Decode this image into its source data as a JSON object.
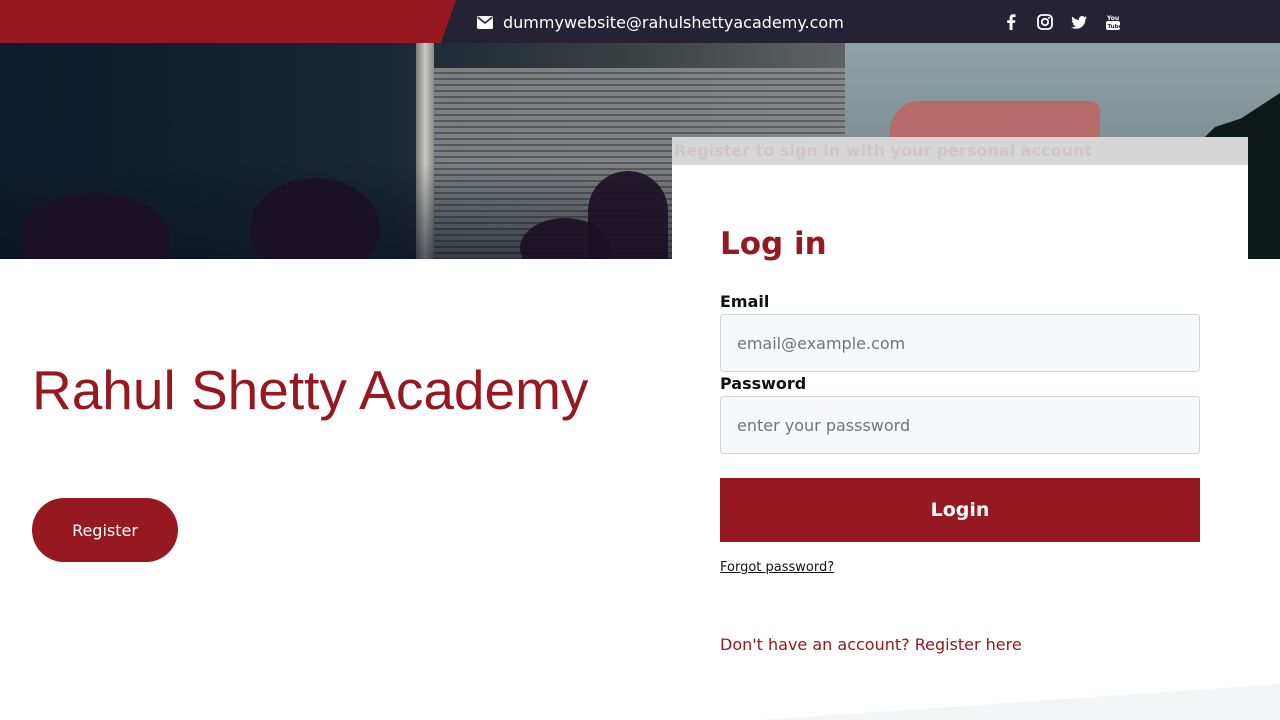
{
  "topbar": {
    "email": "dummywebsite@rahulshettyacademy.com",
    "email_icon": "envelope-icon",
    "social_icons": [
      "facebook-icon",
      "instagram-icon",
      "twitter-icon",
      "youtube-icon"
    ]
  },
  "banner": {
    "text": "Register to sign in with your personal account"
  },
  "brand": {
    "title": "Rahul Shetty Academy",
    "register_button": "Register"
  },
  "login": {
    "title": "Log in",
    "email_label": "Email",
    "email_placeholder": "email@example.com",
    "email_value": "",
    "password_label": "Password",
    "password_placeholder": "enter your passsword",
    "password_value": "",
    "login_button": "Login",
    "forgot_password": "Forgot password?",
    "register_link": "Don't have an account? Register here"
  },
  "colors": {
    "brand_red": "#961820",
    "topbar_dark": "#252333"
  }
}
